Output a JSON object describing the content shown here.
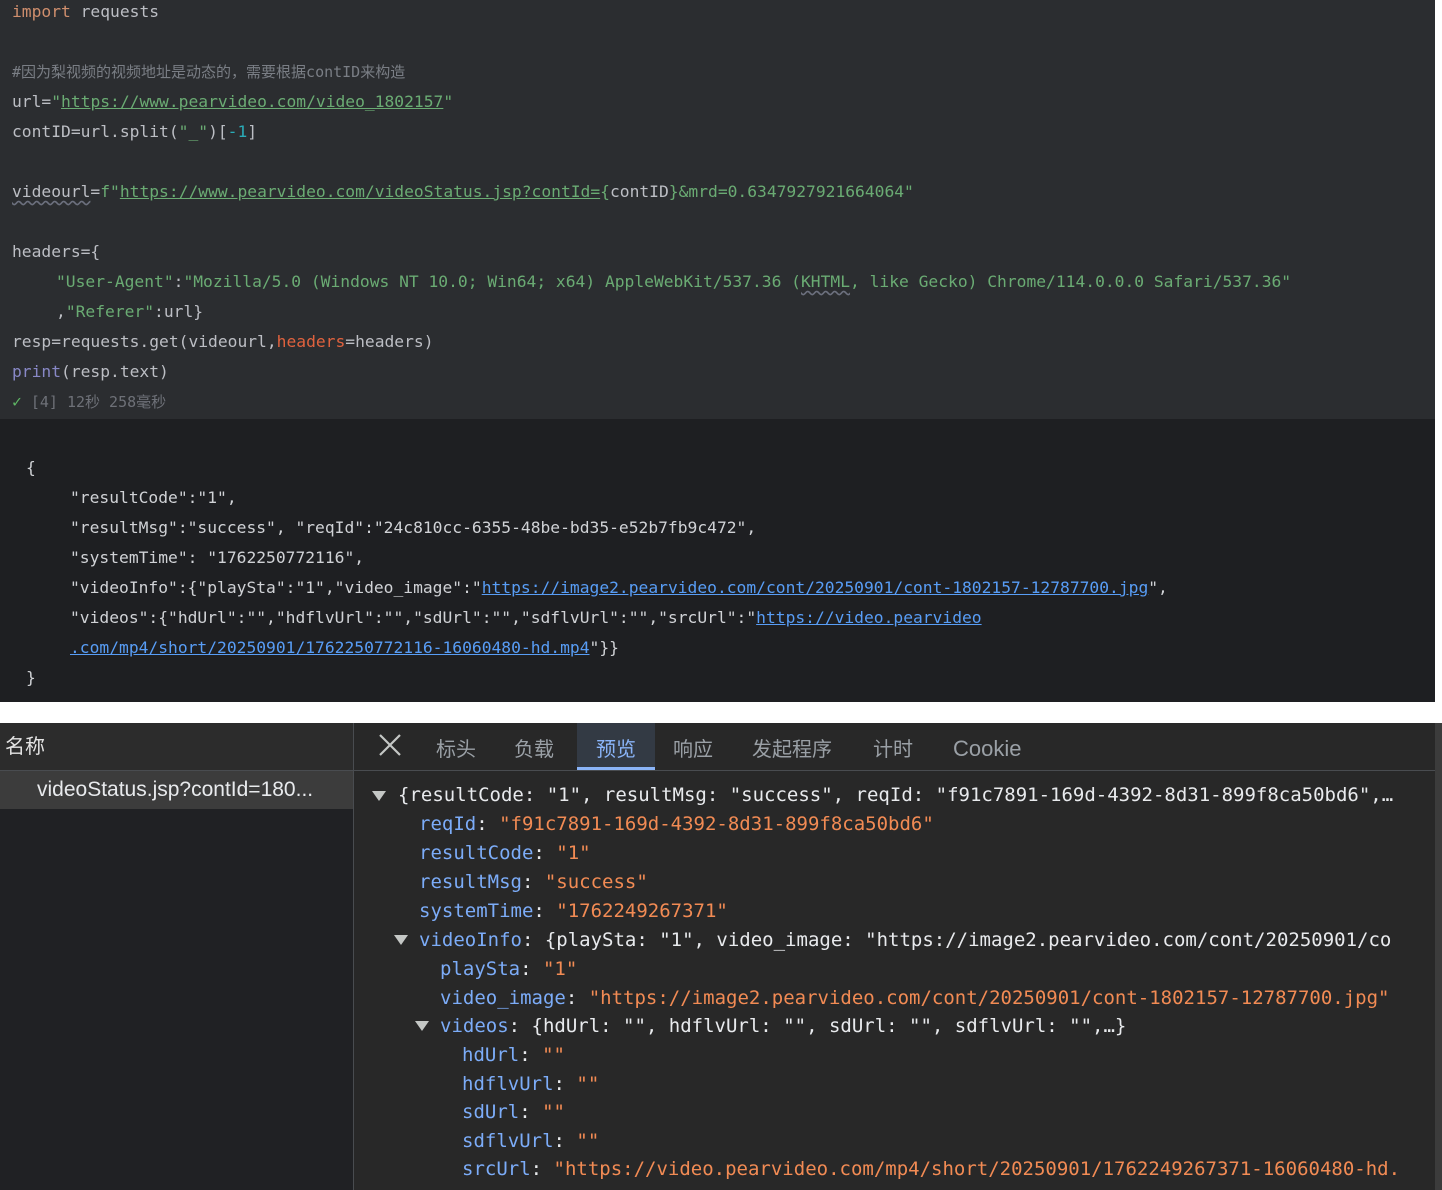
{
  "editor": {
    "lines": {
      "l1": {
        "kw": "import",
        "rest": " requests"
      },
      "l2": {
        "comment": "#因为梨视频的视频地址是动态的，需要根据contID来构造"
      },
      "l3": {
        "pre": "url=",
        "q1": "\"",
        "link": "https://www.pearvideo.com/video_1802157",
        "q2": "\""
      },
      "l4": {
        "pre": "contID=url.split(",
        "str": "\"_\"",
        "mid": ")[",
        "num": "-1",
        "post": "]"
      },
      "l5": {
        "var": "videourl",
        "eq": "=",
        "fq": "f\"",
        "link": "https://www.pearvideo.com/videoStatus.jsp?contId=",
        "brace1": "{",
        "inner": "contID",
        "brace2": "}",
        "tail": "&mrd=0.6347927921664064\""
      },
      "l6": {
        "text": "headers={"
      },
      "l7": {
        "k": "\"User-Agent\"",
        "colon": ":",
        "v1": "\"Mozilla/5.0 (Windows NT 10.0; Win64; x64) AppleWebKit/537.36 (",
        "wavy": "KHTML",
        "v2": ", like Gecko) Chrome/114.0.0.0 Safari/537.36\""
      },
      "l8": {
        "comma": ",",
        "k": "\"Referer\"",
        "rest": ":url}"
      },
      "l9": {
        "pre": "resp=requests.get(videourl,",
        "param": "headers",
        "post": "=headers)"
      },
      "l10": {
        "fn": "print",
        "rest": "(resp.text)"
      }
    },
    "status": {
      "check": "✓",
      "text": " [4] 12秒 258毫秒"
    }
  },
  "output": {
    "open": "{",
    "o1": "\"resultCode\":\"1\",",
    "o2": "\"resultMsg\":\"success\", \"reqId\":\"24c810cc-6355-48be-bd35-e52b7fb9c472\",",
    "o3": "\"systemTime\": \"1762250772116\",",
    "o4": {
      "pre": "\"videoInfo\":{\"playSta\":\"1\",\"video_image\":\"",
      "link": "https://image2.pearvideo.com/cont/20250901/cont-1802157-12787700.jpg",
      "post": "\","
    },
    "o5": {
      "pre": "\"videos\":{\"hdUrl\":\"\",\"hdflvUrl\":\"\",\"sdUrl\":\"\",\"sdflvUrl\":\"\",\"srcUrl\":\"",
      "link": "https://video.pearvideo"
    },
    "o6": {
      "link": ".com/mp4/short/20250901/1762250772116-16060480-hd.mp4",
      "post": "\"}}"
    },
    "close": "}"
  },
  "devtools": {
    "name_header": "名称",
    "request": "videoStatus.jsp?contId=180...",
    "tabs": {
      "headers": "标头",
      "payload": "负载",
      "preview": "预览",
      "response": "响应",
      "initiator": "发起程序",
      "timing": "计时",
      "cookie": "Cookie"
    },
    "active_tab": "预览",
    "tree": {
      "root": "{resultCode: \"1\", resultMsg: \"success\", reqId: \"f91c7891-169d-4392-8d31-899f8ca50bd6\",…",
      "reqId": {
        "k": "reqId",
        "v": "\"f91c7891-169d-4392-8d31-899f8ca50bd6\""
      },
      "resultCode": {
        "k": "resultCode",
        "v": "\"1\""
      },
      "resultMsg": {
        "k": "resultMsg",
        "v": "\"success\""
      },
      "systemTime": {
        "k": "systemTime",
        "v": "\"1762249267371\""
      },
      "videoInfo": {
        "k": "videoInfo",
        "summary": "{playSta: \"1\", video_image: \"https://image2.pearvideo.com/cont/20250901/co"
      },
      "playSta": {
        "k": "playSta",
        "v": "\"1\""
      },
      "video_image": {
        "k": "video_image",
        "v": "\"https://image2.pearvideo.com/cont/20250901/cont-1802157-12787700.jpg\""
      },
      "videos": {
        "k": "videos",
        "summary": "{hdUrl: \"\", hdflvUrl: \"\", sdUrl: \"\", sdflvUrl: \"\",…}"
      },
      "hdUrl": {
        "k": "hdUrl",
        "v": "\"\""
      },
      "hdflvUrl": {
        "k": "hdflvUrl",
        "v": "\"\""
      },
      "sdUrl": {
        "k": "sdUrl",
        "v": "\"\""
      },
      "sdflvUrl": {
        "k": "sdflvUrl",
        "v": "\"\""
      },
      "srcUrl": {
        "k": "srcUrl",
        "v": "\"https://video.pearvideo.com/mp4/short/20250901/1762249267371-16060480-hd."
      }
    }
  },
  "colors": {
    "editor_bg": "#2b2d30",
    "output_bg": "#1e1f22",
    "devtools_bg": "#282828",
    "accent": "#8ab4f8",
    "key": "#7cacf8",
    "value": "#f28b54"
  }
}
